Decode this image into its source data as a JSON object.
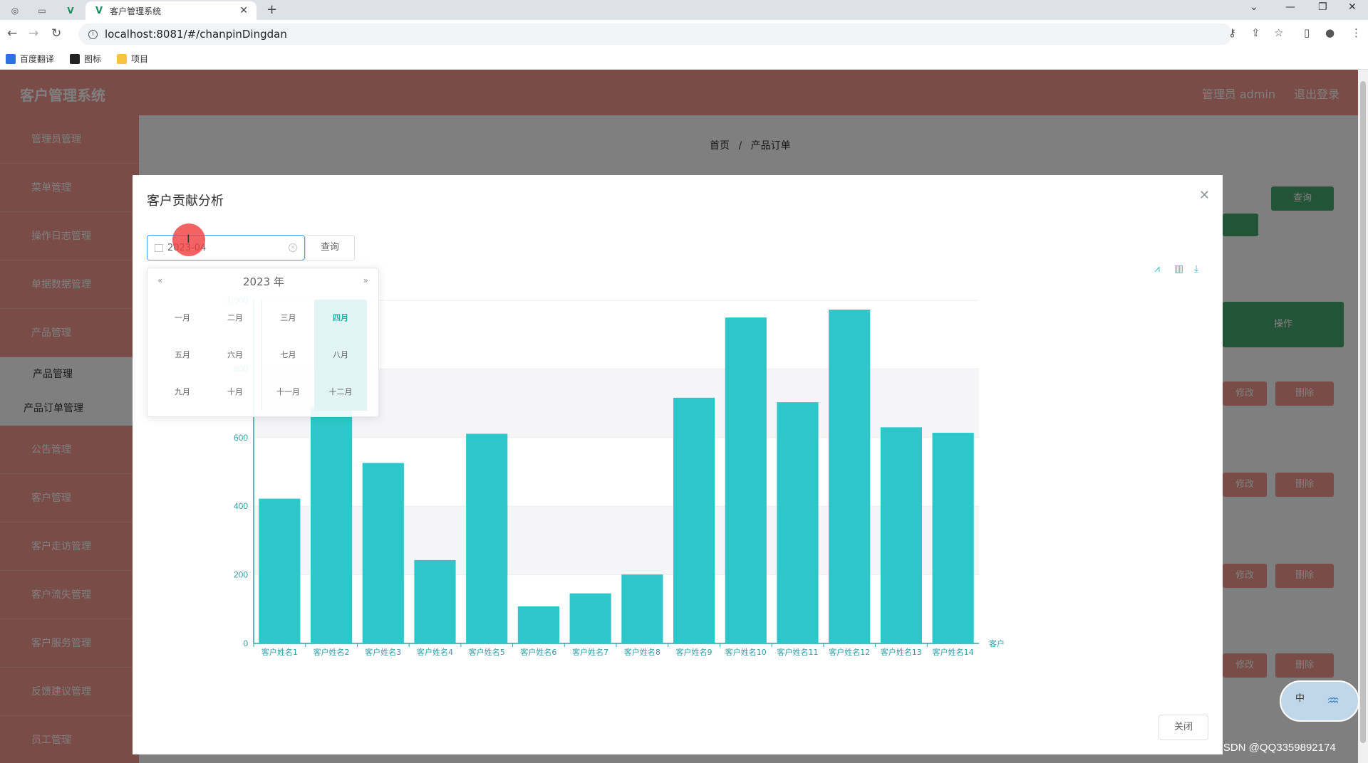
{
  "browser": {
    "tab_title": "客户管理系统",
    "url": "localhost:8081/#/chanpinDingdan",
    "bookmarks": [
      {
        "label": "百度翻译"
      },
      {
        "label": "图标"
      },
      {
        "label": "项目"
      }
    ]
  },
  "app": {
    "title": "客户管理系统",
    "user_label": "管理员 admin",
    "logout_label": "退出登录",
    "breadcrumb": {
      "home": "首页",
      "sep": "/",
      "current": "产品订单"
    },
    "sidebar": {
      "items": [
        "管理员管理",
        "菜单管理",
        "操作日志管理",
        "单据数据管理",
        "产品管理"
      ],
      "sub_items": [
        "产品管理",
        "产品订单管理"
      ],
      "items_after": [
        "公告管理",
        "客户管理",
        "客户走访管理",
        "客户流失管理",
        "客户服务管理",
        "反馈建议管理",
        "员工管理"
      ]
    },
    "buttons": {
      "query": "查询",
      "ops_header": "操作",
      "edit": "修改",
      "delete": "删除"
    },
    "watermark": "CSDN @QQ3359892174"
  },
  "dialog": {
    "title": "客户贡献分析",
    "date_value": "2023-04",
    "query_label": "查询",
    "close_label": "关闭",
    "picker": {
      "year_label": "2023 年",
      "prev": "«",
      "next": "»",
      "months": [
        "一月",
        "二月",
        "三月",
        "四月",
        "五月",
        "六月",
        "七月",
        "八月",
        "九月",
        "十月",
        "十一月",
        "十二月"
      ],
      "selected": "四月"
    }
  },
  "chart_data": {
    "type": "bar",
    "x_axis_name": "客户",
    "categories": [
      "客户姓名1",
      "客户姓名2",
      "客户姓名3",
      "客户姓名4",
      "客户姓名5",
      "客户姓名6",
      "客户姓名7",
      "客户姓名8",
      "客户姓名9",
      "客户姓名10",
      "客户姓名11",
      "客户姓名12",
      "客户姓名13",
      "客户姓名14"
    ],
    "values": [
      422,
      690,
      526,
      243,
      611,
      108,
      146,
      201,
      716,
      950,
      703,
      973,
      630,
      614
    ],
    "yticks": [
      "0",
      "200",
      "400",
      "600",
      "800",
      "1,000"
    ],
    "ylim": [
      0,
      1000
    ],
    "color": "#2ec7c9",
    "grid": true
  }
}
